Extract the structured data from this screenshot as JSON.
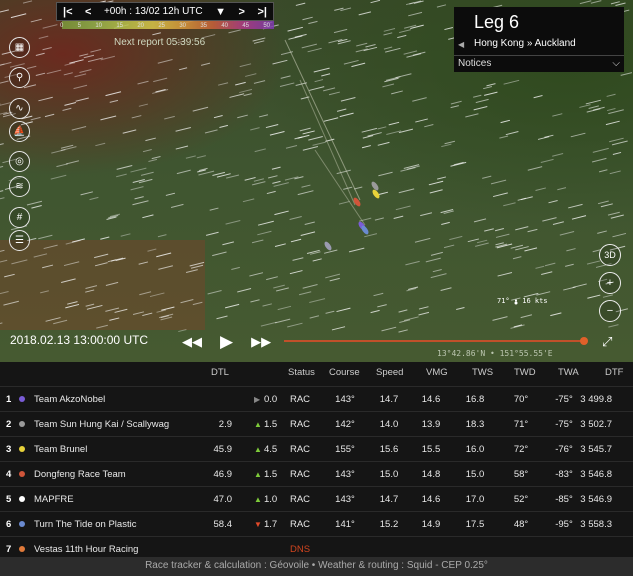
{
  "timebar": {
    "label": "+00h : 13/02 12h UTC",
    "first": "|<",
    "prev": "<",
    "dropdown": "▼",
    "next": ">",
    "last": ">|"
  },
  "legend_ticks": [
    "0",
    "5",
    "10",
    "15",
    "20",
    "25",
    "30",
    "35",
    "40",
    "45",
    "50"
  ],
  "next_report": "Next report 05:39:56",
  "leg": {
    "title": "Leg 6",
    "route": "Hong Kong » Auckland",
    "notices": "Notices"
  },
  "map": {
    "wind_label": "71° • 16 kts",
    "coords": "13°42.86'N • 151°55.55'E"
  },
  "playback": {
    "datetime": "2018.02.13 13:00:00 UTC"
  },
  "right_controls": {
    "view3d": "3D"
  },
  "table": {
    "headers": {
      "dtl": "DTL",
      "status": "Status",
      "course": "Course",
      "speed": "Speed",
      "vmg": "VMG",
      "tws": "TWS",
      "twd": "TWD",
      "twa": "TWA",
      "dtf": "DTF"
    },
    "rows": [
      {
        "rank": "1",
        "color": "#7a5cd6",
        "team": "Team AkzoNobel",
        "dtl": "",
        "trend": "▶",
        "trend_class": "neu",
        "delta": "0.0",
        "status": "RAC",
        "course": "143°",
        "speed": "14.7",
        "vmg": "14.6",
        "tws": "16.8",
        "twd": "70°",
        "twa": "-75°",
        "dtf": "3 499.8"
      },
      {
        "rank": "2",
        "color": "#9a9a9a",
        "team": "Team Sun Hung Kai / Scallywag",
        "dtl": "2.9",
        "trend": "▲",
        "trend_class": "up",
        "delta": "1.5",
        "status": "RAC",
        "course": "142°",
        "speed": "14.0",
        "vmg": "13.9",
        "tws": "18.3",
        "twd": "71°",
        "twa": "-75°",
        "dtf": "3 502.7"
      },
      {
        "rank": "3",
        "color": "#e8d23a",
        "team": "Team Brunel",
        "dtl": "45.9",
        "trend": "▲",
        "trend_class": "up",
        "delta": "4.5",
        "status": "RAC",
        "course": "155°",
        "speed": "15.6",
        "vmg": "15.5",
        "tws": "16.0",
        "twd": "72°",
        "twa": "-76°",
        "dtf": "3 545.7"
      },
      {
        "rank": "4",
        "color": "#d0553a",
        "team": "Dongfeng Race Team",
        "dtl": "46.9",
        "trend": "▲",
        "trend_class": "up",
        "delta": "1.5",
        "status": "RAC",
        "course": "143°",
        "speed": "15.0",
        "vmg": "14.8",
        "tws": "15.0",
        "twd": "58°",
        "twa": "-83°",
        "dtf": "3 546.8"
      },
      {
        "rank": "5",
        "color": "#ffffff",
        "team": "MAPFRE",
        "dtl": "47.0",
        "trend": "▲",
        "trend_class": "up",
        "delta": "1.0",
        "status": "RAC",
        "course": "143°",
        "speed": "14.7",
        "vmg": "14.6",
        "tws": "17.0",
        "twd": "52°",
        "twa": "-85°",
        "dtf": "3 546.9"
      },
      {
        "rank": "6",
        "color": "#6a8ad0",
        "team": "Turn The Tide on Plastic",
        "dtl": "58.4",
        "trend": "▼",
        "trend_class": "down",
        "delta": "1.7",
        "status": "RAC",
        "course": "141°",
        "speed": "15.2",
        "vmg": "14.9",
        "tws": "17.5",
        "twd": "48°",
        "twa": "-95°",
        "dtf": "3 558.3"
      },
      {
        "rank": "7",
        "color": "#e07a3a",
        "team": "Vestas 11th Hour Racing",
        "dtl": "",
        "trend": "",
        "trend_class": "neu",
        "delta": "",
        "status": "DNS",
        "course": "",
        "speed": "",
        "vmg": "",
        "tws": "",
        "twd": "",
        "twa": "",
        "dtf": ""
      }
    ]
  },
  "footer": "Race tracker & calculation : Géovoile • Weather & routing : Squid - CEP 0.25°"
}
